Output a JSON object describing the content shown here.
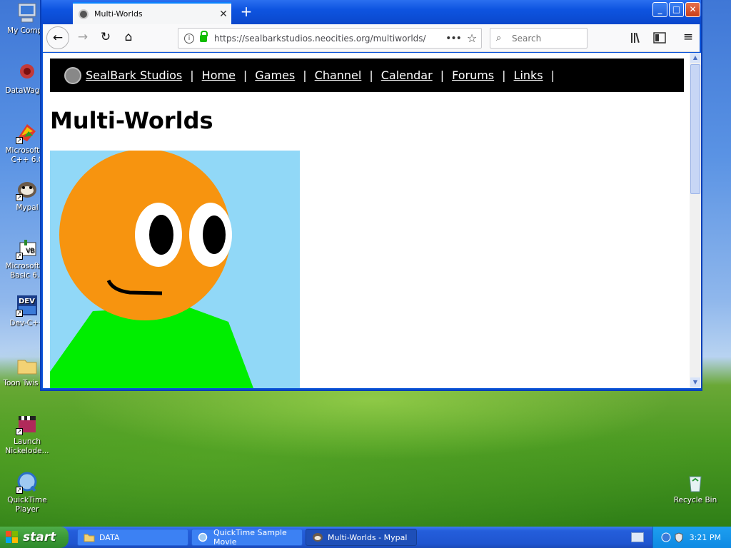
{
  "desktop": {
    "icons": [
      {
        "label": "My Compu",
        "icon": "my-computer-icon"
      },
      {
        "label": "DataWagon",
        "icon": "datawagon-icon"
      },
      {
        "label": "Microsoft Vi C++ 6.0",
        "icon": "visual-cpp-icon"
      },
      {
        "label": "Mypal",
        "icon": "mypal-browser-icon"
      },
      {
        "label": "Microsoft Vi Basic 6.0",
        "icon": "visual-basic-icon"
      },
      {
        "label": "Dev-C++",
        "icon": "dev-cpp-icon"
      },
      {
        "label": "Toon Twis 3D",
        "icon": "folder-icon"
      },
      {
        "label": "Launch Nickelode...",
        "icon": "clapperboard-icon"
      },
      {
        "label": "QuickTime Player",
        "icon": "quicktime-icon"
      },
      {
        "label": "Recycle Bin",
        "icon": "recycle-bin-icon"
      }
    ]
  },
  "browser": {
    "tab_title": "Multi-Worlds",
    "new_tab_symbol": "+",
    "url": "https://sealbarkstudios.neocities.org/multiworlds/",
    "search_placeholder": "Search",
    "window_buttons": {
      "minimize": "_",
      "maximize": "□",
      "close": "✕"
    }
  },
  "page": {
    "site_name": "SealBark Studios",
    "nav_links": [
      "Home",
      "Games",
      "Channel",
      "Calendar",
      "Forums",
      "Links"
    ],
    "separator": "|",
    "title": "Multi-Worlds",
    "colors": {
      "sky": "#91d8f7",
      "head": "#f7940f",
      "body": "#00ee00",
      "nav_bg": "#000000"
    }
  },
  "taskbar": {
    "start_label": "start",
    "tasks": [
      {
        "label": "DATA",
        "icon": "folder-icon",
        "active": false
      },
      {
        "label": "QuickTime Sample Movie",
        "icon": "quicktime-icon",
        "active": false
      },
      {
        "label": "Multi-Worlds - Mypal",
        "icon": "mypal-browser-icon",
        "active": true
      }
    ],
    "clock": "3:21 PM"
  }
}
